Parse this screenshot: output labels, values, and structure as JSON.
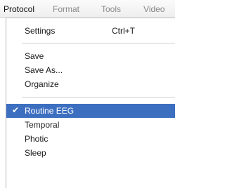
{
  "menubar": {
    "items": [
      {
        "label": "Protocol",
        "state": "active"
      },
      {
        "label": "Format",
        "state": "inactive"
      },
      {
        "label": "Tools",
        "state": "inactive"
      },
      {
        "label": "Video",
        "state": "inactive"
      }
    ]
  },
  "protocol_menu": {
    "settings": {
      "label": "Settings",
      "shortcut": "Ctrl+T"
    },
    "save": {
      "label": "Save"
    },
    "save_as": {
      "label": "Save As..."
    },
    "organize": {
      "label": "Organize"
    },
    "routine_eeg": {
      "label": "Routine EEG",
      "checked": true,
      "check_icon": "check-icon"
    },
    "temporal": {
      "label": "Temporal"
    },
    "photic": {
      "label": "Photic"
    },
    "sleep": {
      "label": "Sleep"
    }
  },
  "colors": {
    "selection": "#3d6fc0",
    "inactive_text": "#8a8a8a"
  }
}
